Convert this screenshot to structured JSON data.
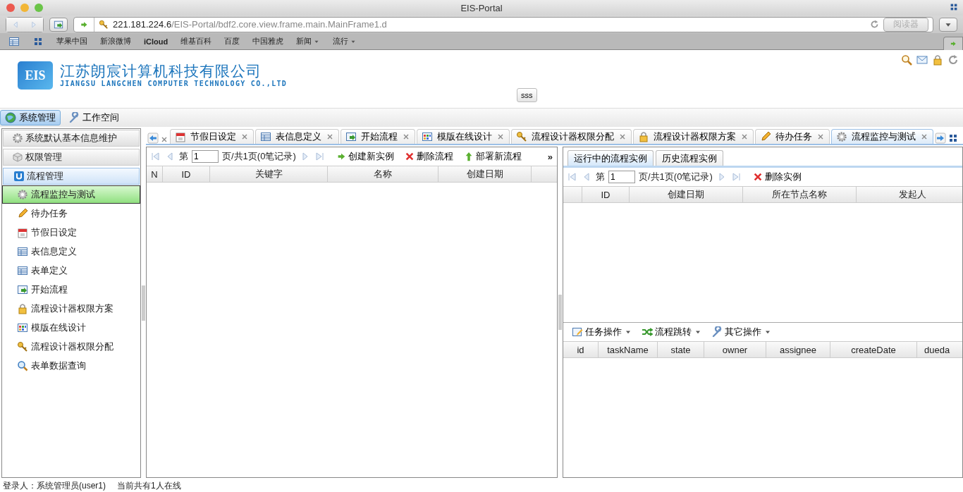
{
  "browser": {
    "title": "EIS-Portal",
    "url_host": "221.181.224.6",
    "url_path": "/EIS-Portal/bdf2.core.view.frame.main.MainFrame1.d",
    "reader_button": "阅读器",
    "bookmarks": [
      {
        "label": "苹果中国",
        "menu": false
      },
      {
        "label": "新浪微博",
        "menu": false
      },
      {
        "label": "iCloud",
        "menu": false
      },
      {
        "label": "维基百科",
        "menu": false
      },
      {
        "label": "百度",
        "menu": false
      },
      {
        "label": "中国雅虎",
        "menu": false
      },
      {
        "label": "新闻",
        "menu": true
      },
      {
        "label": "流行",
        "menu": true
      }
    ]
  },
  "header": {
    "company": "江苏朗宸计算机科技有限公司",
    "company_en": "JIANGSU LANGCHEN COMPUTER TECHNOLOGY CO.,LTD",
    "logo": "EIS",
    "button": "sss"
  },
  "menu": [
    {
      "label": "系统管理",
      "selected": true
    },
    {
      "label": "工作空间",
      "selected": false
    }
  ],
  "sidebar": {
    "sections": [
      {
        "label": "系统默认基本信息维护",
        "expanded": false
      },
      {
        "label": "权限管理",
        "expanded": false
      },
      {
        "label": "流程管理",
        "expanded": true,
        "children": [
          {
            "label": "流程监控与测试",
            "selected": true
          },
          {
            "label": "待办任务",
            "selected": false
          },
          {
            "label": "节假日设定",
            "selected": false
          },
          {
            "label": "表信息定义",
            "selected": false
          },
          {
            "label": "表单定义",
            "selected": false
          },
          {
            "label": "开始流程",
            "selected": false
          },
          {
            "label": "流程设计器权限方案",
            "selected": false
          },
          {
            "label": "模版在线设计",
            "selected": false
          },
          {
            "label": "流程设计器权限分配",
            "selected": false
          },
          {
            "label": "表单数据查询",
            "selected": false
          }
        ]
      }
    ]
  },
  "tabs": [
    {
      "label": "节假日设定",
      "selected": false
    },
    {
      "label": "表信息定义",
      "selected": false
    },
    {
      "label": "开始流程",
      "selected": false
    },
    {
      "label": "模版在线设计",
      "selected": false
    },
    {
      "label": "流程设计器权限分配",
      "selected": false
    },
    {
      "label": "流程设计器权限方案",
      "selected": false
    },
    {
      "label": "待办任务",
      "selected": false
    },
    {
      "label": "流程监控与测试",
      "selected": true
    }
  ],
  "process_panel": {
    "pager": {
      "prefix": "第",
      "page": "1",
      "suffix": "页/共1页(0笔记录)"
    },
    "actions": [
      "创建新实例",
      "删除流程",
      "部署新流程"
    ],
    "more": "»",
    "row_header": "N",
    "columns": [
      "ID",
      "关键字",
      "名称",
      "创建日期"
    ]
  },
  "instance_panel": {
    "tabs": [
      {
        "label": "运行中的流程实例",
        "selected": true
      },
      {
        "label": "历史流程实例",
        "selected": false
      }
    ],
    "pager": {
      "prefix": "第",
      "page": "1",
      "suffix": "页/共1页(0笔记录)"
    },
    "actions": [
      "删除实例"
    ],
    "columns": [
      "ID",
      "创建日期",
      "所在节点名称",
      "发起人"
    ]
  },
  "task_panel": {
    "menus": [
      "任务操作",
      "流程跳转",
      "其它操作"
    ],
    "columns": [
      "id",
      "taskName",
      "state",
      "owner",
      "assignee",
      "createDate",
      "dueda"
    ]
  },
  "status_bar": {
    "user": "登录人：系统管理员(user1)",
    "online": "当前共有1人在线"
  }
}
